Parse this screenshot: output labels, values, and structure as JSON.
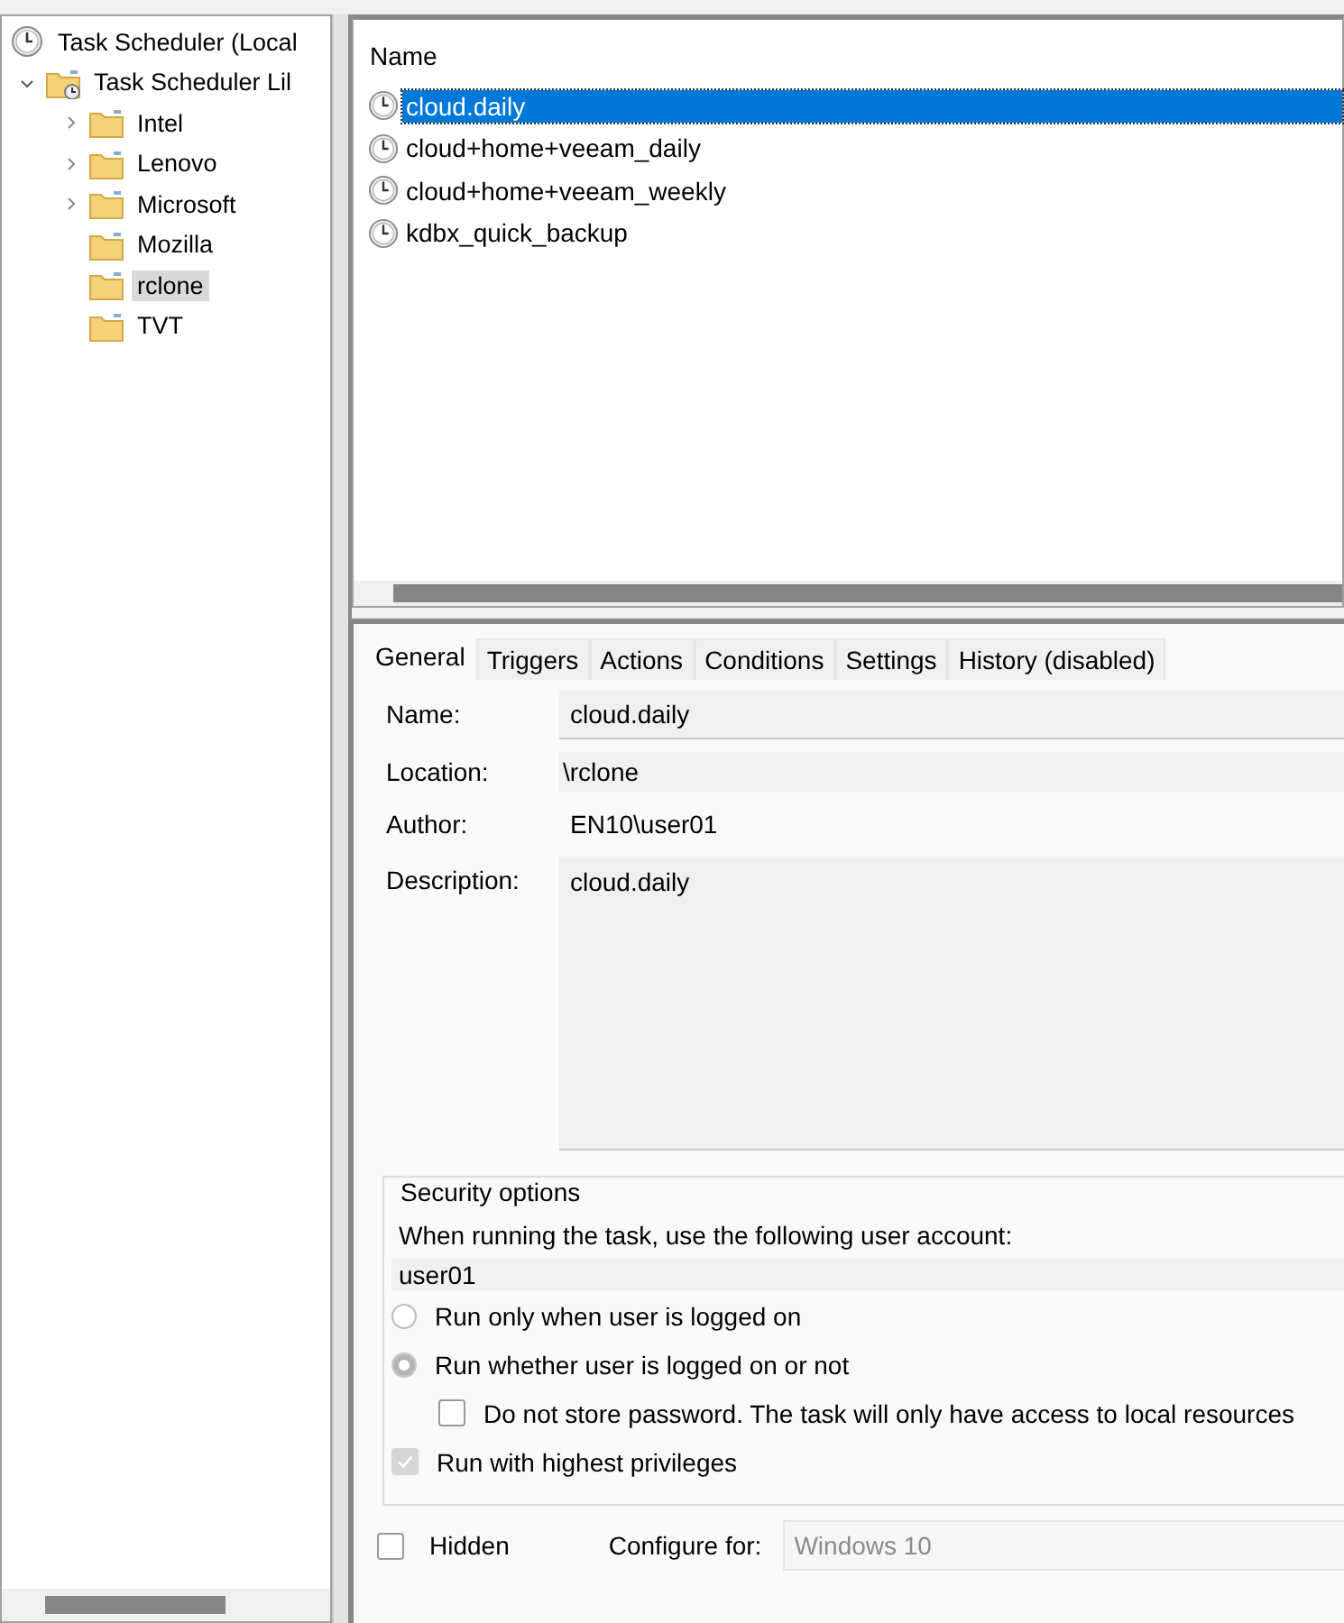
{
  "tree": [
    {
      "label": "Task Scheduler (Local",
      "kind": "root",
      "selected": false,
      "children": [
        {
          "label": "Task Scheduler Lil",
          "kind": "library",
          "expandable": true,
          "expanded": true,
          "selected": false,
          "children": [
            {
              "label": "Intel",
              "kind": "folder",
              "expandable": true,
              "expanded": false,
              "selected": false
            },
            {
              "label": "Lenovo",
              "kind": "folder",
              "expandable": true,
              "expanded": false,
              "selected": false
            },
            {
              "label": "Microsoft",
              "kind": "folder",
              "expandable": true,
              "expanded": false,
              "selected": false
            },
            {
              "label": "Mozilla",
              "kind": "folder",
              "expandable": false,
              "selected": false
            },
            {
              "label": "rclone",
              "kind": "folder",
              "expandable": false,
              "selected": true
            },
            {
              "label": "TVT",
              "kind": "folder",
              "expandable": false,
              "selected": false
            }
          ]
        }
      ]
    }
  ],
  "task_list": {
    "columns": [
      "Name"
    ],
    "rows": [
      {
        "name": "cloud.daily",
        "selected": true
      },
      {
        "name": "cloud+home+veeam_daily",
        "selected": false
      },
      {
        "name": "cloud+home+veeam_weekly",
        "selected": false
      },
      {
        "name": "kdbx_quick_backup",
        "selected": false
      }
    ]
  },
  "tabs": [
    {
      "label": "General",
      "selected": true
    },
    {
      "label": "Triggers",
      "selected": false
    },
    {
      "label": "Actions",
      "selected": false
    },
    {
      "label": "Conditions",
      "selected": false
    },
    {
      "label": "Settings",
      "selected": false
    },
    {
      "label": "History (disabled)",
      "selected": false
    }
  ],
  "general": {
    "fields": [
      {
        "label": "Name:",
        "value": "cloud.daily",
        "kind": "box"
      },
      {
        "label": "Location:",
        "value": "\\rclone",
        "kind": "plain"
      },
      {
        "label": "Author:",
        "value": "EN10\\user01",
        "kind": "text"
      },
      {
        "label": "Description:",
        "value": "cloud.daily",
        "kind": "area"
      }
    ],
    "security": {
      "title": "Security options",
      "prompt": "When running the task, use the following user account:",
      "account": "user01",
      "options": [
        {
          "kind": "radio",
          "label": "Run only when user is logged on",
          "selected": false,
          "disabled": false,
          "indented": false
        },
        {
          "kind": "radio",
          "label": "Run whether user is logged on or not",
          "selected": true,
          "disabled": true,
          "indented": false
        },
        {
          "kind": "checkbox",
          "label": "Do not store password.  The task will only have access to local resources",
          "checked": false,
          "disabled": false,
          "indented": true
        },
        {
          "kind": "checkbox",
          "label": "Run with highest privileges",
          "checked": true,
          "disabled": true,
          "indented": false
        }
      ]
    },
    "hidden": {
      "label": "Hidden",
      "checked": false
    },
    "configure": {
      "label": "Configure for:",
      "value": "Windows 10",
      "disabled": true
    }
  }
}
